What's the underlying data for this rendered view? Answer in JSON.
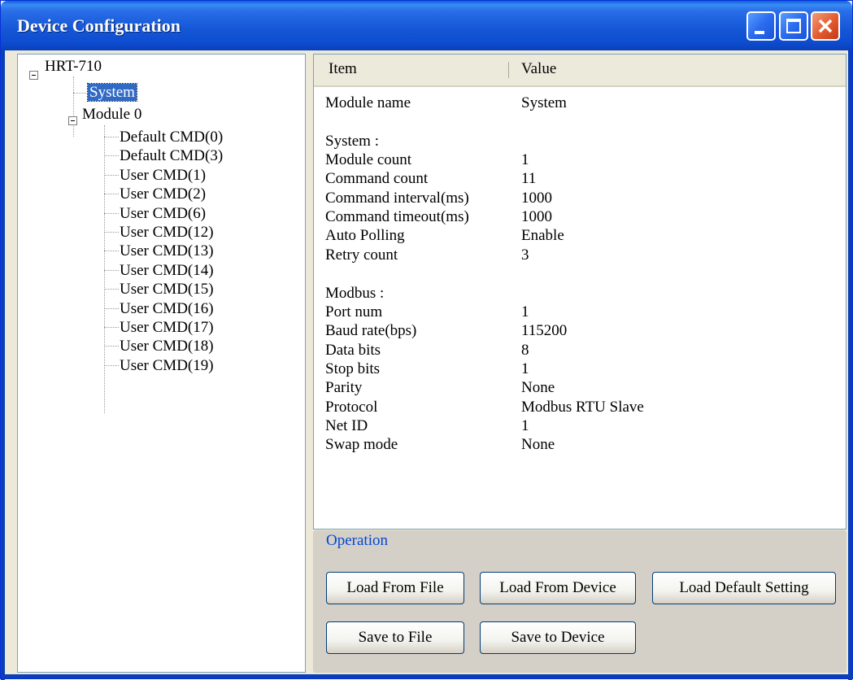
{
  "window": {
    "title": "Device Configuration"
  },
  "tree": {
    "root_label": "HRT-710",
    "system_label": "System",
    "module_label": "Module 0",
    "children": [
      "Default CMD(0)",
      "Default CMD(3)",
      "User CMD(1)",
      "User CMD(2)",
      "User CMD(6)",
      "User CMD(12)",
      "User CMD(13)",
      "User CMD(14)",
      "User CMD(15)",
      "User CMD(16)",
      "User CMD(17)",
      "User CMD(18)",
      "User CMD(19)"
    ]
  },
  "listview": {
    "columns": [
      "Item",
      "Value"
    ],
    "rows": [
      {
        "item": "Module name",
        "value": "System"
      },
      {
        "item": "",
        "value": ""
      },
      {
        "item": "System :",
        "value": ""
      },
      {
        "item": "Module count",
        "value": "1"
      },
      {
        "item": "Command count",
        "value": "11"
      },
      {
        "item": "Command interval(ms)",
        "value": "1000"
      },
      {
        "item": "Command timeout(ms)",
        "value": "1000"
      },
      {
        "item": "Auto Polling",
        "value": "Enable"
      },
      {
        "item": "Retry count",
        "value": "3"
      },
      {
        "item": "",
        "value": ""
      },
      {
        "item": "Modbus :",
        "value": ""
      },
      {
        "item": "Port num",
        "value": "1"
      },
      {
        "item": "Baud rate(bps)",
        "value": "115200"
      },
      {
        "item": "Data bits",
        "value": "8"
      },
      {
        "item": "Stop bits",
        "value": "1"
      },
      {
        "item": "Parity",
        "value": "None"
      },
      {
        "item": "Protocol",
        "value": "Modbus RTU Slave"
      },
      {
        "item": "Net ID",
        "value": "1"
      },
      {
        "item": "Swap mode",
        "value": "None"
      }
    ]
  },
  "operation": {
    "label": "Operation",
    "buttons": {
      "load_from_file": "Load From File",
      "load_from_device": "Load From Device",
      "load_default": "Load Default Setting",
      "save_to_file": "Save to File",
      "save_to_device": "Save to Device"
    }
  }
}
